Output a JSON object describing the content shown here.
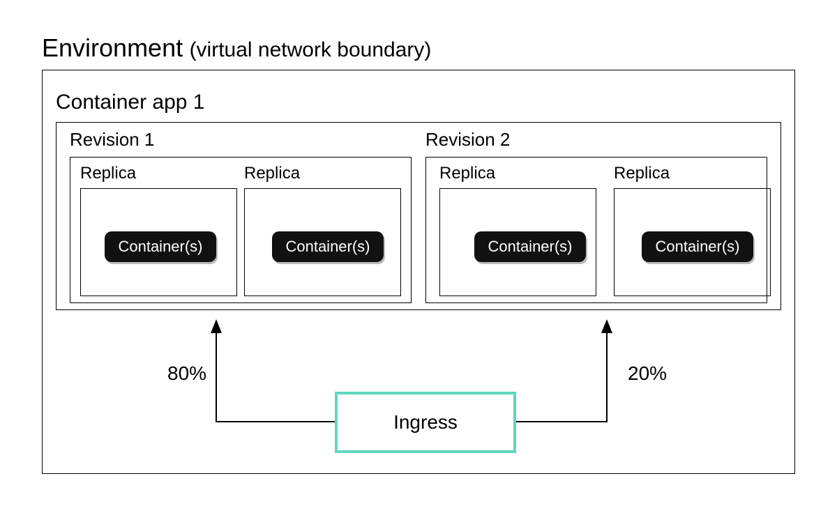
{
  "title": {
    "strong": "Environment",
    "paren": "(virtual network boundary)"
  },
  "app": {
    "label": "Container app 1"
  },
  "revisions": {
    "r1": {
      "label": "Revision 1"
    },
    "r2": {
      "label": "Revision 2"
    }
  },
  "replica_label": "Replica",
  "container_chip": "Container(s)",
  "ingress": {
    "label": "Ingress"
  },
  "traffic": {
    "left_pct": "80%",
    "right_pct": "20%"
  }
}
